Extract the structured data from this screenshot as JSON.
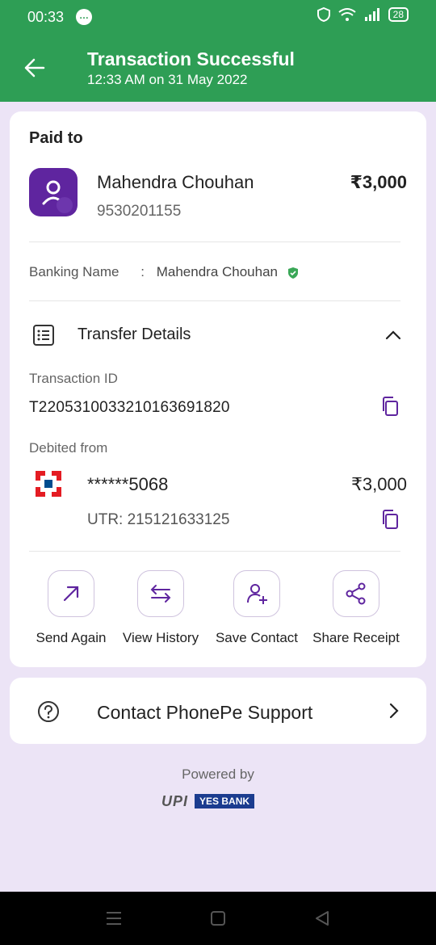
{
  "status_bar": {
    "time": "00:33",
    "battery": "28"
  },
  "header": {
    "title": "Transaction Successful",
    "subtitle": "12:33 AM on 31 May 2022"
  },
  "paid_to": {
    "label": "Paid to",
    "name": "Mahendra Chouhan",
    "phone": "9530201155",
    "amount": "₹3,000"
  },
  "banking": {
    "label": "Banking Name",
    "separator": ":",
    "name": "Mahendra Chouhan"
  },
  "transfer": {
    "title": "Transfer Details",
    "transaction_id_label": "Transaction ID",
    "transaction_id": "T2205310033210163691820",
    "debited_label": "Debited from",
    "account_masked": "******5068",
    "amount": "₹3,000",
    "utr": "UTR: 215121633125"
  },
  "actions": [
    {
      "label": "Send Again",
      "icon": "arrow-up-right-icon"
    },
    {
      "label": "View History",
      "icon": "swap-arrows-icon"
    },
    {
      "label": "Save Contact",
      "icon": "add-user-icon"
    },
    {
      "label": "Share Receipt",
      "icon": "share-icon"
    }
  ],
  "support": {
    "label": "Contact PhonePe Support"
  },
  "footer": {
    "powered_by": "Powered by",
    "upi": "UPI",
    "bank": "YES BANK"
  },
  "colors": {
    "header": "#2e9e55",
    "brand_purple": "#5f259f",
    "background": "#ece4f6"
  }
}
